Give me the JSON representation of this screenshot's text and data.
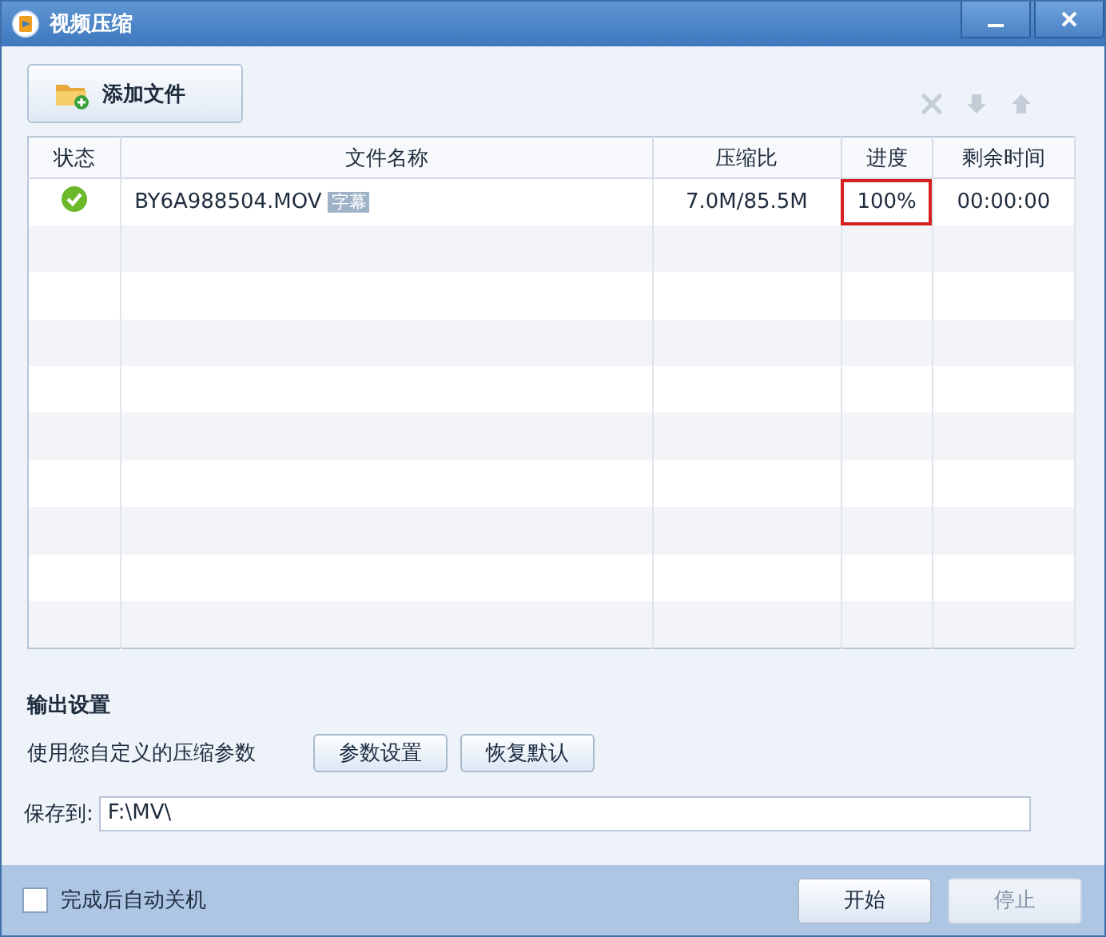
{
  "window": {
    "title": "视频压缩"
  },
  "toolbar": {
    "add_button": "添加文件",
    "actions": [
      {
        "kind": "delete",
        "disabled": true
      },
      {
        "kind": "down",
        "disabled": true
      },
      {
        "kind": "up",
        "disabled": true
      }
    ]
  },
  "table": {
    "columns": [
      "状态",
      "文件名称",
      "压缩比",
      "进度",
      "剩余时间"
    ],
    "rows": [
      {
        "completed": true,
        "name": "BY6A988504.MOV",
        "tag": "字幕",
        "ratio": "7.0M/85.5M",
        "progress": "100%",
        "remaining": "00:00:00",
        "progress_highlighted": true
      }
    ]
  },
  "output": {
    "heading": "输出设置",
    "description": "使用您自定义的压缩参数",
    "buttons": [
      "参数设置",
      "恢复默认"
    ],
    "save_label": "保存到:",
    "save_path": "F:\\MV\\"
  },
  "footer": {
    "shutdown": {
      "label": "完成后自动关机",
      "checked": false
    },
    "buttons": [
      {
        "label": "开始",
        "disabled": false
      },
      {
        "label": "停止",
        "disabled": true
      }
    ]
  }
}
